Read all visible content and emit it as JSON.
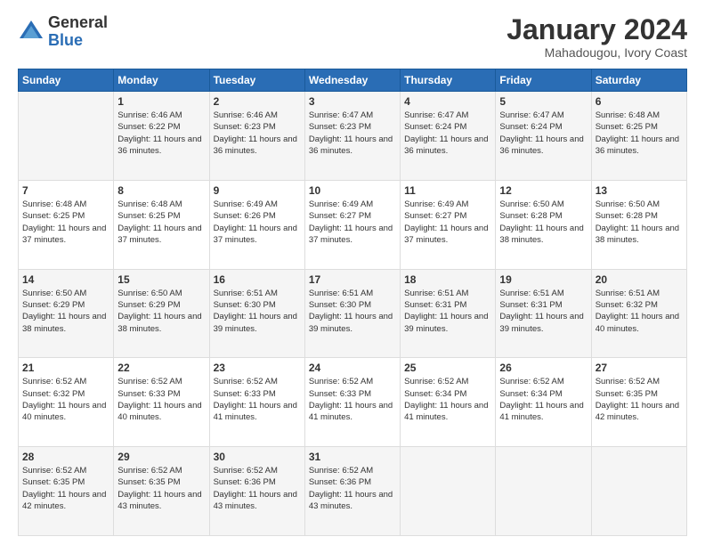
{
  "logo": {
    "general": "General",
    "blue": "Blue"
  },
  "title": "January 2024",
  "subtitle": "Mahadougou, Ivory Coast",
  "header_days": [
    "Sunday",
    "Monday",
    "Tuesday",
    "Wednesday",
    "Thursday",
    "Friday",
    "Saturday"
  ],
  "weeks": [
    [
      {
        "day": "",
        "sunrise": "",
        "sunset": "",
        "daylight": ""
      },
      {
        "day": "1",
        "sunrise": "Sunrise: 6:46 AM",
        "sunset": "Sunset: 6:22 PM",
        "daylight": "Daylight: 11 hours and 36 minutes."
      },
      {
        "day": "2",
        "sunrise": "Sunrise: 6:46 AM",
        "sunset": "Sunset: 6:23 PM",
        "daylight": "Daylight: 11 hours and 36 minutes."
      },
      {
        "day": "3",
        "sunrise": "Sunrise: 6:47 AM",
        "sunset": "Sunset: 6:23 PM",
        "daylight": "Daylight: 11 hours and 36 minutes."
      },
      {
        "day": "4",
        "sunrise": "Sunrise: 6:47 AM",
        "sunset": "Sunset: 6:24 PM",
        "daylight": "Daylight: 11 hours and 36 minutes."
      },
      {
        "day": "5",
        "sunrise": "Sunrise: 6:47 AM",
        "sunset": "Sunset: 6:24 PM",
        "daylight": "Daylight: 11 hours and 36 minutes."
      },
      {
        "day": "6",
        "sunrise": "Sunrise: 6:48 AM",
        "sunset": "Sunset: 6:25 PM",
        "daylight": "Daylight: 11 hours and 36 minutes."
      }
    ],
    [
      {
        "day": "7",
        "sunrise": "Sunrise: 6:48 AM",
        "sunset": "Sunset: 6:25 PM",
        "daylight": "Daylight: 11 hours and 37 minutes."
      },
      {
        "day": "8",
        "sunrise": "Sunrise: 6:48 AM",
        "sunset": "Sunset: 6:25 PM",
        "daylight": "Daylight: 11 hours and 37 minutes."
      },
      {
        "day": "9",
        "sunrise": "Sunrise: 6:49 AM",
        "sunset": "Sunset: 6:26 PM",
        "daylight": "Daylight: 11 hours and 37 minutes."
      },
      {
        "day": "10",
        "sunrise": "Sunrise: 6:49 AM",
        "sunset": "Sunset: 6:27 PM",
        "daylight": "Daylight: 11 hours and 37 minutes."
      },
      {
        "day": "11",
        "sunrise": "Sunrise: 6:49 AM",
        "sunset": "Sunset: 6:27 PM",
        "daylight": "Daylight: 11 hours and 37 minutes."
      },
      {
        "day": "12",
        "sunrise": "Sunrise: 6:50 AM",
        "sunset": "Sunset: 6:28 PM",
        "daylight": "Daylight: 11 hours and 38 minutes."
      },
      {
        "day": "13",
        "sunrise": "Sunrise: 6:50 AM",
        "sunset": "Sunset: 6:28 PM",
        "daylight": "Daylight: 11 hours and 38 minutes."
      }
    ],
    [
      {
        "day": "14",
        "sunrise": "Sunrise: 6:50 AM",
        "sunset": "Sunset: 6:29 PM",
        "daylight": "Daylight: 11 hours and 38 minutes."
      },
      {
        "day": "15",
        "sunrise": "Sunrise: 6:50 AM",
        "sunset": "Sunset: 6:29 PM",
        "daylight": "Daylight: 11 hours and 38 minutes."
      },
      {
        "day": "16",
        "sunrise": "Sunrise: 6:51 AM",
        "sunset": "Sunset: 6:30 PM",
        "daylight": "Daylight: 11 hours and 39 minutes."
      },
      {
        "day": "17",
        "sunrise": "Sunrise: 6:51 AM",
        "sunset": "Sunset: 6:30 PM",
        "daylight": "Daylight: 11 hours and 39 minutes."
      },
      {
        "day": "18",
        "sunrise": "Sunrise: 6:51 AM",
        "sunset": "Sunset: 6:31 PM",
        "daylight": "Daylight: 11 hours and 39 minutes."
      },
      {
        "day": "19",
        "sunrise": "Sunrise: 6:51 AM",
        "sunset": "Sunset: 6:31 PM",
        "daylight": "Daylight: 11 hours and 39 minutes."
      },
      {
        "day": "20",
        "sunrise": "Sunrise: 6:51 AM",
        "sunset": "Sunset: 6:32 PM",
        "daylight": "Daylight: 11 hours and 40 minutes."
      }
    ],
    [
      {
        "day": "21",
        "sunrise": "Sunrise: 6:52 AM",
        "sunset": "Sunset: 6:32 PM",
        "daylight": "Daylight: 11 hours and 40 minutes."
      },
      {
        "day": "22",
        "sunrise": "Sunrise: 6:52 AM",
        "sunset": "Sunset: 6:33 PM",
        "daylight": "Daylight: 11 hours and 40 minutes."
      },
      {
        "day": "23",
        "sunrise": "Sunrise: 6:52 AM",
        "sunset": "Sunset: 6:33 PM",
        "daylight": "Daylight: 11 hours and 41 minutes."
      },
      {
        "day": "24",
        "sunrise": "Sunrise: 6:52 AM",
        "sunset": "Sunset: 6:33 PM",
        "daylight": "Daylight: 11 hours and 41 minutes."
      },
      {
        "day": "25",
        "sunrise": "Sunrise: 6:52 AM",
        "sunset": "Sunset: 6:34 PM",
        "daylight": "Daylight: 11 hours and 41 minutes."
      },
      {
        "day": "26",
        "sunrise": "Sunrise: 6:52 AM",
        "sunset": "Sunset: 6:34 PM",
        "daylight": "Daylight: 11 hours and 41 minutes."
      },
      {
        "day": "27",
        "sunrise": "Sunrise: 6:52 AM",
        "sunset": "Sunset: 6:35 PM",
        "daylight": "Daylight: 11 hours and 42 minutes."
      }
    ],
    [
      {
        "day": "28",
        "sunrise": "Sunrise: 6:52 AM",
        "sunset": "Sunset: 6:35 PM",
        "daylight": "Daylight: 11 hours and 42 minutes."
      },
      {
        "day": "29",
        "sunrise": "Sunrise: 6:52 AM",
        "sunset": "Sunset: 6:35 PM",
        "daylight": "Daylight: 11 hours and 43 minutes."
      },
      {
        "day": "30",
        "sunrise": "Sunrise: 6:52 AM",
        "sunset": "Sunset: 6:36 PM",
        "daylight": "Daylight: 11 hours and 43 minutes."
      },
      {
        "day": "31",
        "sunrise": "Sunrise: 6:52 AM",
        "sunset": "Sunset: 6:36 PM",
        "daylight": "Daylight: 11 hours and 43 minutes."
      },
      {
        "day": "",
        "sunrise": "",
        "sunset": "",
        "daylight": ""
      },
      {
        "day": "",
        "sunrise": "",
        "sunset": "",
        "daylight": ""
      },
      {
        "day": "",
        "sunrise": "",
        "sunset": "",
        "daylight": ""
      }
    ]
  ]
}
